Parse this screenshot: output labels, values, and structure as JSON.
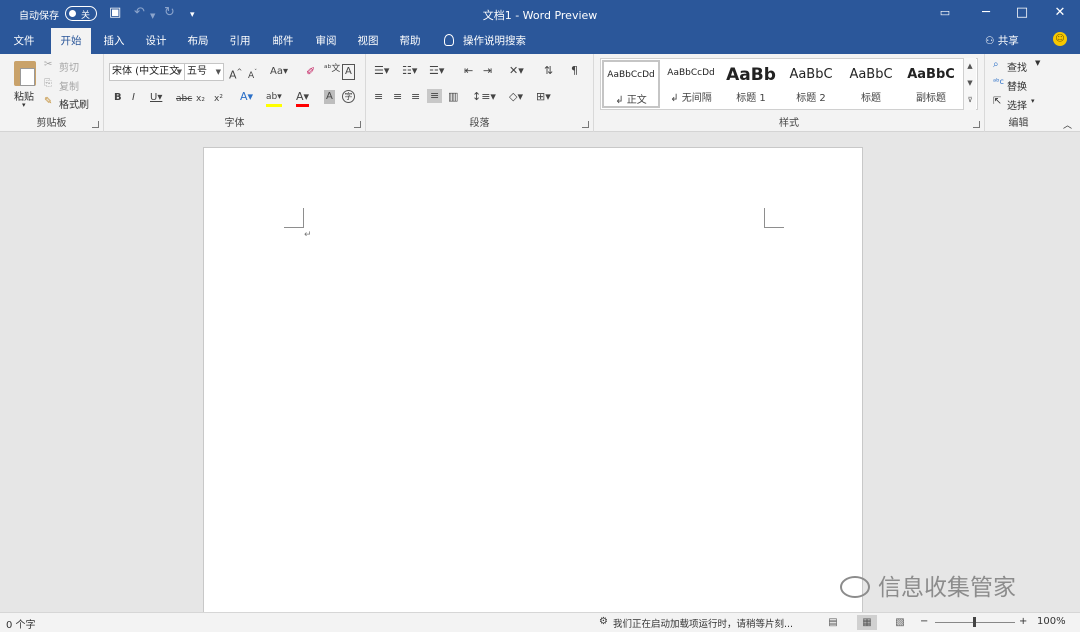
{
  "titlebar": {
    "autosave_label": "自动保存",
    "autosave_state": "关",
    "title": "文档1  -  Word Preview",
    "qat": {
      "save_icon": "save-icon",
      "undo_icon": "undo-icon",
      "redo_icon": "redo-icon",
      "customize_icon": "customize-qat-icon"
    },
    "window_buttons": [
      "ribbon-display-options-icon",
      "minimize-icon",
      "maximize-icon",
      "close-icon"
    ]
  },
  "tabs": [
    "文件",
    "开始",
    "插入",
    "设计",
    "布局",
    "引用",
    "邮件",
    "审阅",
    "视图",
    "帮助"
  ],
  "active_tab": "开始",
  "tell_me": "操作说明搜索",
  "share": "共享",
  "ribbon": {
    "clipboard": {
      "label": "剪贴板",
      "paste": "粘贴",
      "cut": "剪切",
      "copy": "复制",
      "format_painter": "格式刷"
    },
    "font": {
      "label": "字体",
      "font_name": "宋体 (中文正文",
      "font_size": "五号",
      "change_case": "Aa"
    },
    "paragraph": {
      "label": "段落"
    },
    "styles": {
      "label": "样式",
      "items": [
        {
          "preview": "AaBbCcDd",
          "name": "正文"
        },
        {
          "preview": "AaBbCcDd",
          "name": "无间隔"
        },
        {
          "preview": "AaBb",
          "name": "标题 1"
        },
        {
          "preview": "AaBbC",
          "name": "标题 2"
        },
        {
          "preview": "AaBbC",
          "name": "标题"
        },
        {
          "preview": "AaBbC",
          "name": "副标题"
        }
      ]
    },
    "editing": {
      "label": "编辑",
      "find": "查找",
      "replace": "替换",
      "select": "选择"
    }
  },
  "document": {
    "paragraph_mark": "↵"
  },
  "watermark": "信息收集管家",
  "status": {
    "word_count": "0 个字",
    "addin_message": "我们正在启动加载项运行时，请稍等片刻...",
    "zoom": "100%",
    "zoom_minus": "−",
    "zoom_plus": "+"
  },
  "colors": {
    "brand": "#2b579a",
    "ribbon_bg": "#f3f3f3",
    "highlight": "#ffff00",
    "font_color": "#ff0000"
  }
}
